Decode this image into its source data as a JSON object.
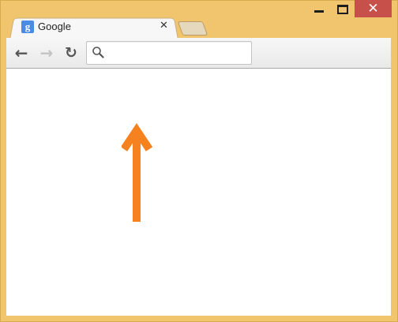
{
  "window": {
    "minimize_icon": "minimize-icon",
    "maximize_icon": "maximize-icon",
    "close_label": "✕",
    "frame_color": "#f0c56e",
    "close_color": "#c7504b"
  },
  "tabs": [
    {
      "title": "Google",
      "favicon_letter": "g",
      "close_label": "✕"
    }
  ],
  "toolbar": {
    "back_label": "←",
    "forward_label": "→",
    "reload_label": "↻"
  },
  "omnibox": {
    "value": "",
    "search_icon": "search-icon"
  },
  "annotation": {
    "arrow_color": "#f6821f"
  }
}
